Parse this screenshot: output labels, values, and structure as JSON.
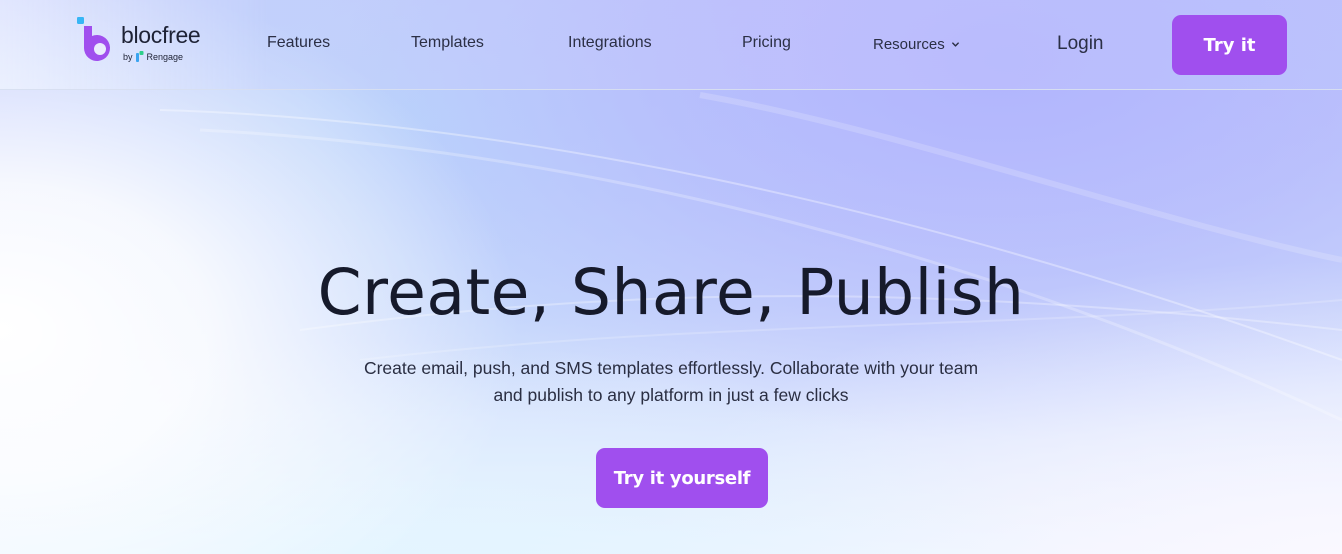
{
  "brand": {
    "name": "blocfree",
    "by_prefix": "by",
    "parent": "Rengage",
    "colors": {
      "primary": "#a04fee",
      "accent_square": "#38b6f5",
      "text_dark": "#161a2b"
    }
  },
  "nav": {
    "items": [
      {
        "label": "Features"
      },
      {
        "label": "Templates"
      },
      {
        "label": "Integrations"
      },
      {
        "label": "Pricing"
      },
      {
        "label": "Resources",
        "icon": "chevron-down-icon"
      }
    ],
    "login_label": "Login",
    "cta_label": "Try it"
  },
  "hero": {
    "title": "Create, Share, Publish",
    "subtitle_line1": "Create email, push, and SMS templates effortlessly. Collaborate with your team",
    "subtitle_line2": "and publish to any platform in just a few clicks",
    "cta_label": "Try it yourself"
  }
}
